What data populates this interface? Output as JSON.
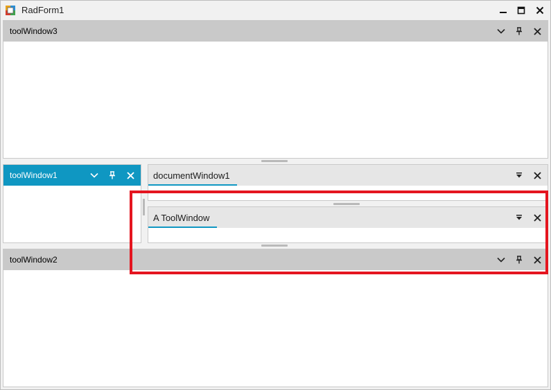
{
  "window": {
    "title": "RadForm1",
    "minimize_icon": "minimize-icon",
    "maximize_icon": "maximize-icon",
    "close_icon": "close-icon"
  },
  "tool_windows": {
    "top": {
      "title": "toolWindow3"
    },
    "left": {
      "title": "toolWindow1"
    },
    "bottom": {
      "title": "toolWindow2"
    }
  },
  "documents": {
    "document": {
      "tab_label": "documentWindow1"
    },
    "tool": {
      "tab_label": "A ToolWindow"
    }
  },
  "colors": {
    "accent": "#0f97c2",
    "caption": "#c9c9c9",
    "highlight": "#e4151f"
  }
}
